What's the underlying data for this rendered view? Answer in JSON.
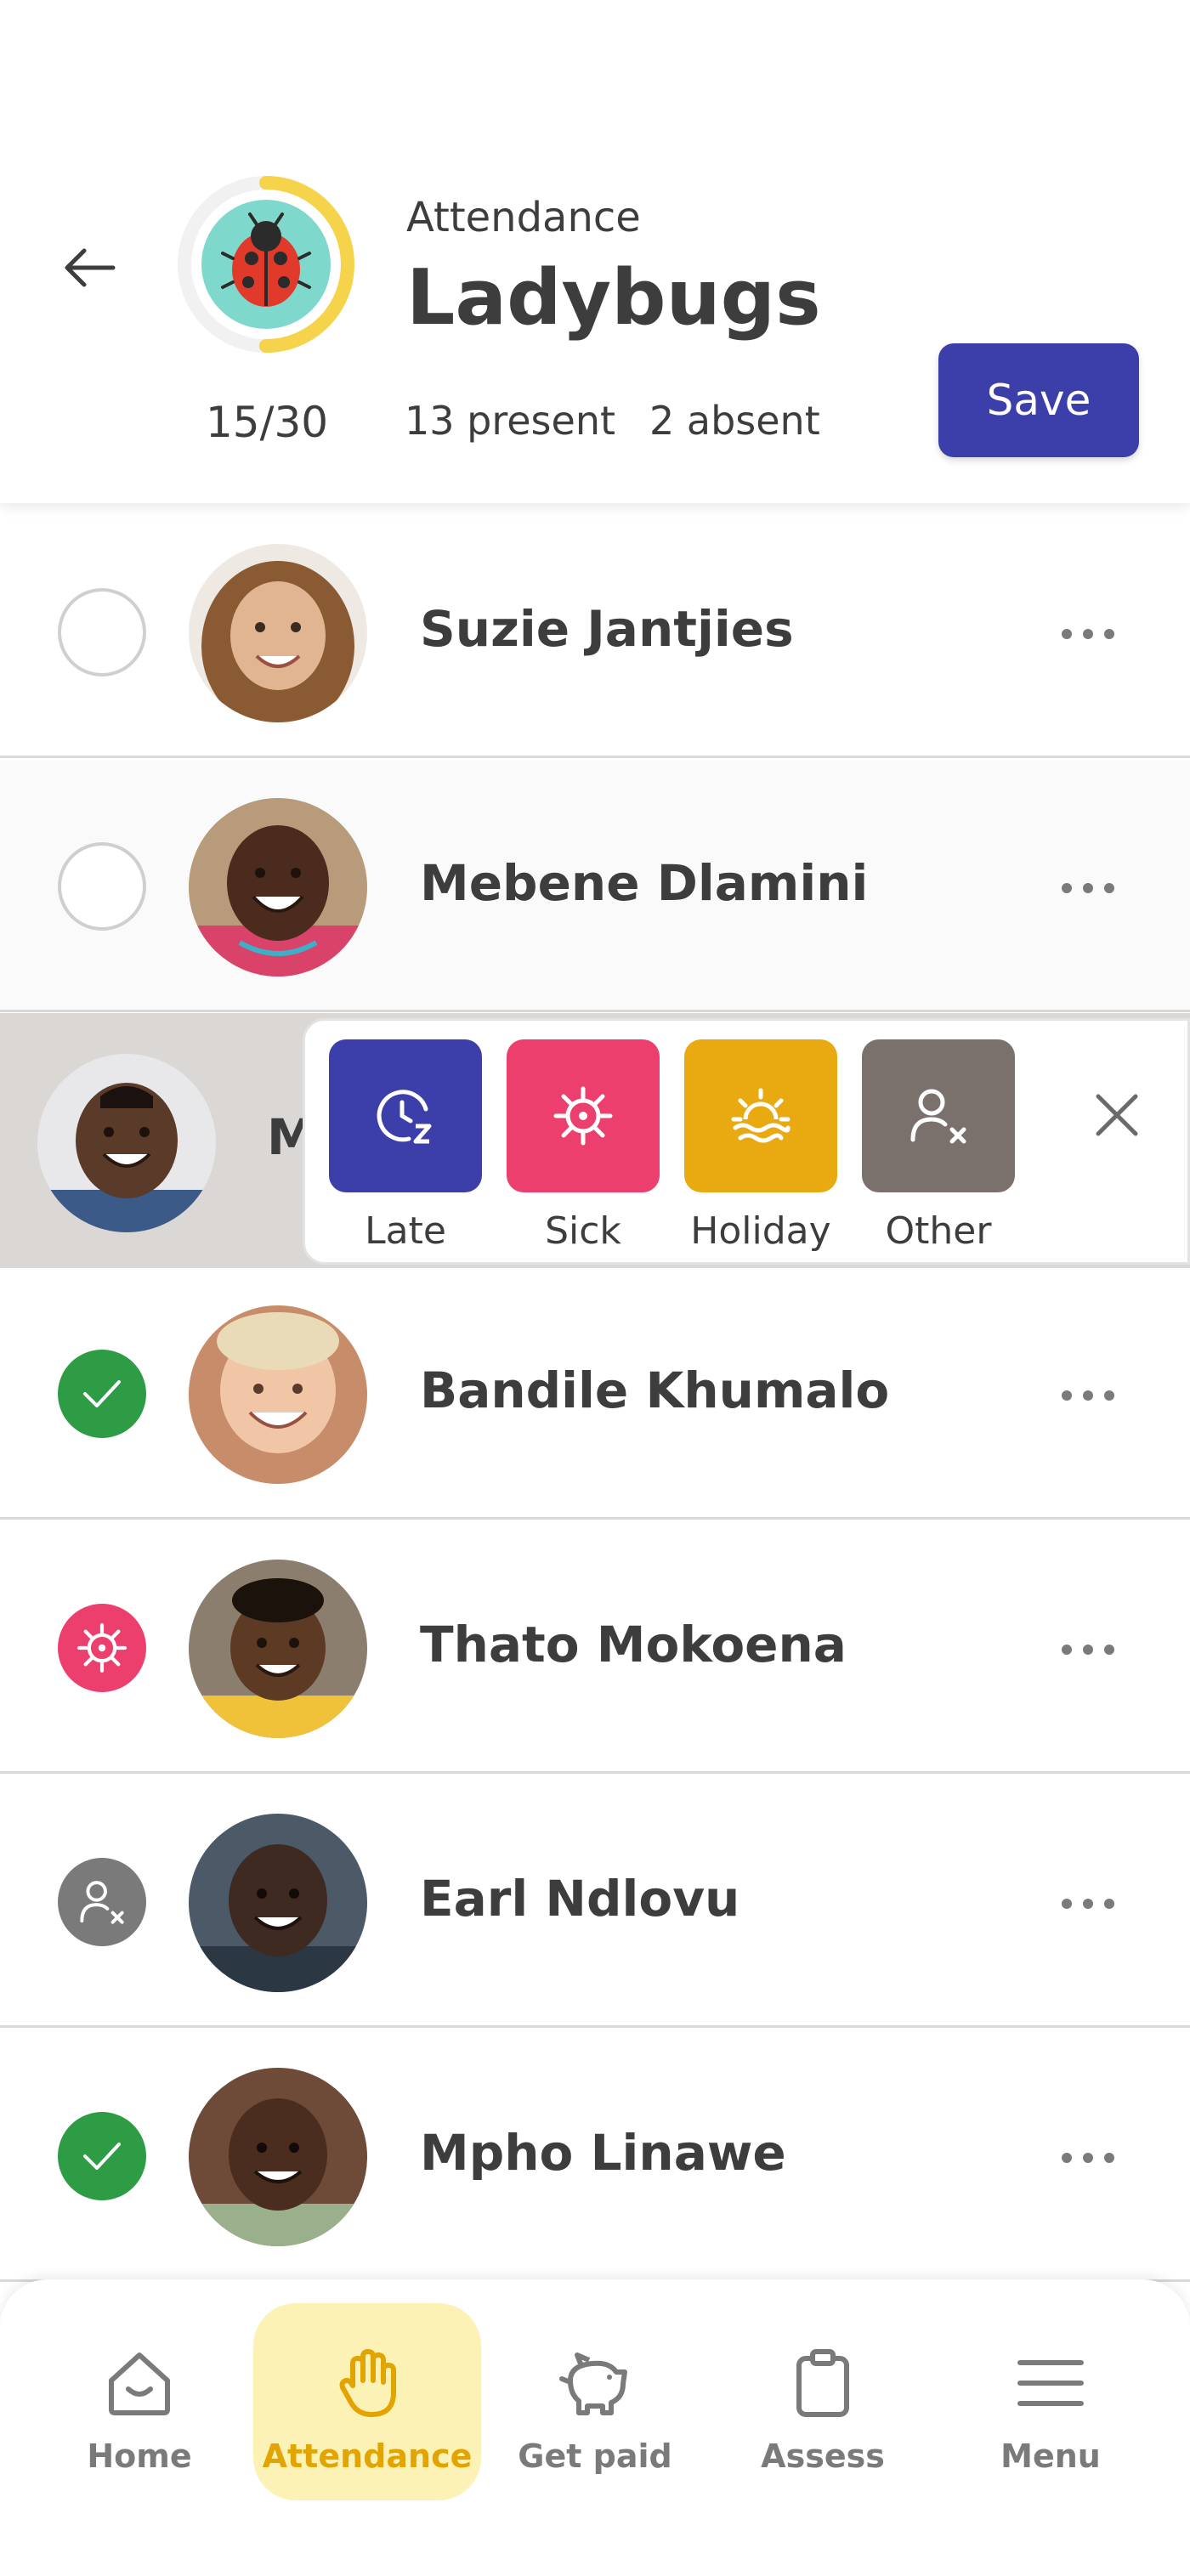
{
  "header": {
    "subtitle": "Attendance",
    "title": "Ladybugs",
    "count": "15/30",
    "present": "13 present",
    "absent": "2 absent",
    "save_label": "Save",
    "progress_fraction": 0.5
  },
  "children": [
    {
      "name": "Suzie Jantjies",
      "status": "unmarked",
      "avatar_color": "#c89b6e"
    },
    {
      "name": "Mebene Dlamini",
      "status": "unmarked",
      "avatar_color": "#4a2b1d"
    }
  ],
  "open_row": {
    "name_peek": "M",
    "avatar_color": "#5a3a29",
    "reasons": [
      {
        "label": "Late",
        "icon": "clock-icon",
        "color": "#3c3faa"
      },
      {
        "label": "Sick",
        "icon": "virus-icon",
        "color": "#ec3f6e"
      },
      {
        "label": "Holiday",
        "icon": "sun-icon",
        "color": "#e8aa10"
      },
      {
        "label": "Other",
        "icon": "person-x-icon",
        "color": "#7a716c"
      }
    ]
  },
  "children_after": [
    {
      "name": "Bandile Khumalo",
      "status": "present",
      "avatar_color": "#d89a7c"
    },
    {
      "name": "Thato Mokoena",
      "status": "sick",
      "avatar_color": "#5d3a23"
    },
    {
      "name": "Earl Ndlovu",
      "status": "other",
      "avatar_color": "#3e2a20"
    },
    {
      "name": "Mpho Linawe",
      "status": "present",
      "avatar_color": "#4b2d20"
    }
  ],
  "nav": [
    {
      "label": "Home",
      "icon": "home-icon",
      "active": false
    },
    {
      "label": "Attendance",
      "icon": "hand-icon",
      "active": true
    },
    {
      "label": "Get paid",
      "icon": "piggy-bank-icon",
      "active": false
    },
    {
      "label": "Assess",
      "icon": "clipboard-icon",
      "active": false
    },
    {
      "label": "Menu",
      "icon": "menu-icon",
      "active": false
    }
  ],
  "colors": {
    "primary": "#3c3faa",
    "present": "#2e9b45",
    "sick": "#ec3f6e",
    "holiday": "#e8aa10",
    "other": "#7a716c",
    "nav_active_bg": "#fdf2b6",
    "nav_active_text": "#e2a400",
    "ring_track": "#f1f1f1",
    "ring_fill": "#f5d44c",
    "ladybug_bg": "#7fd8cc"
  }
}
